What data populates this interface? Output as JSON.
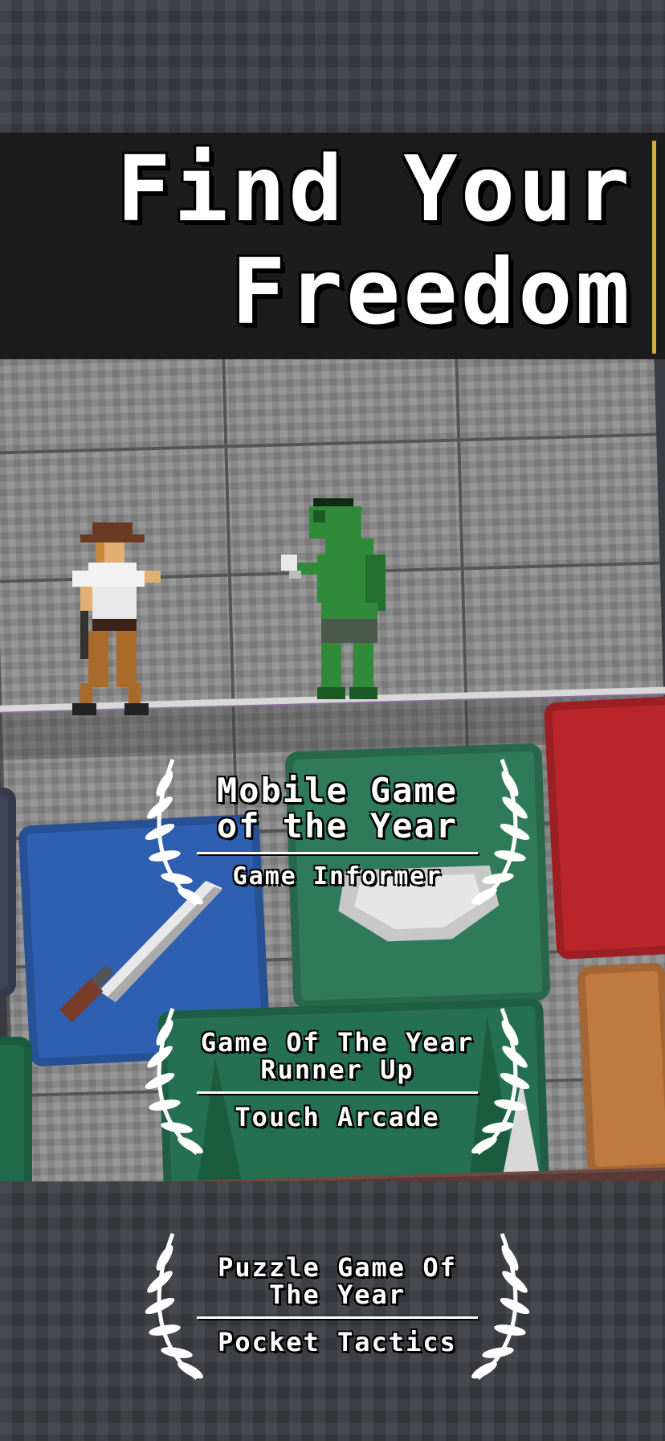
{
  "headline": {
    "line1": "Find Your",
    "line2": "Freedom"
  },
  "characters": [
    {
      "icon": "explorer-sprite"
    },
    {
      "icon": "zombie-sprite"
    }
  ],
  "awards": [
    {
      "title_line1": "Mobile Game",
      "title_line2": "of the Year",
      "source": "Game Informer"
    },
    {
      "title_line1": "Game Of The Year",
      "title_line2": "Runner Up",
      "source": "Touch Arcade"
    },
    {
      "title_line1": "Puzzle Game Of",
      "title_line2": "The Year",
      "source": "Pocket Tactics"
    }
  ],
  "colors": {
    "title_band": "#1c1c1d",
    "accent_gold": "#d8a93a",
    "card_blue": "#2e5fb0",
    "card_green": "#2f7a5a",
    "card_red": "#b8262a"
  }
}
